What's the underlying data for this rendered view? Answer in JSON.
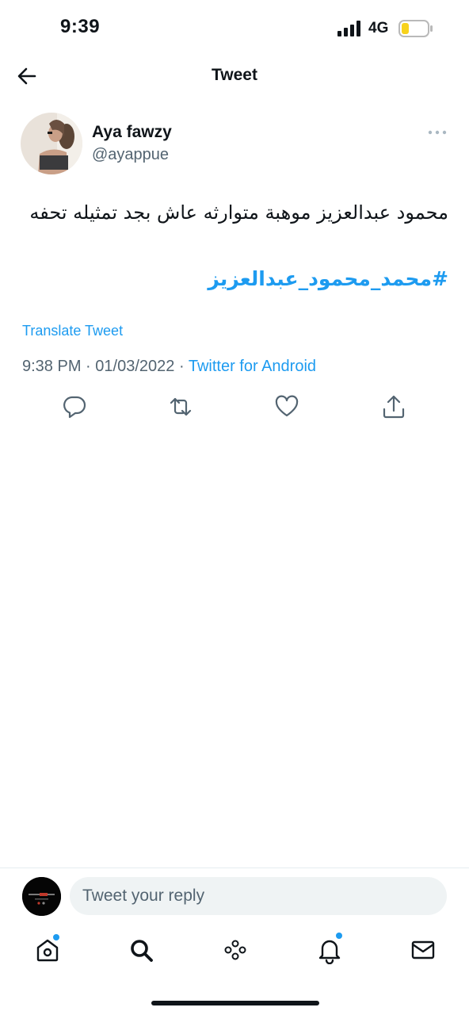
{
  "status_bar": {
    "time": "9:39",
    "network": "4G"
  },
  "header": {
    "title": "Tweet"
  },
  "tweet": {
    "author_name": "Aya fawzy",
    "author_handle": "@ayappue",
    "text": "محمود عبدالعزيز موهبة متوارثه عاش بجد تمثيله تحفه",
    "hashtag": "#محمد_محمود_عبدالعزيز",
    "translate_label": "Translate Tweet",
    "time": "9:38 PM",
    "date": "01/03/2022",
    "source": "Twitter for Android",
    "separator": "·"
  },
  "reply": {
    "placeholder": "Tweet your reply"
  },
  "colors": {
    "accent": "#1d9bf0",
    "text": "#0f1419",
    "secondary": "#536471"
  },
  "icons": {
    "actions": [
      "reply-icon",
      "retweet-icon",
      "like-icon",
      "share-icon"
    ],
    "nav": [
      "home-icon",
      "search-icon",
      "spaces-icon",
      "notifications-icon",
      "messages-icon"
    ]
  }
}
